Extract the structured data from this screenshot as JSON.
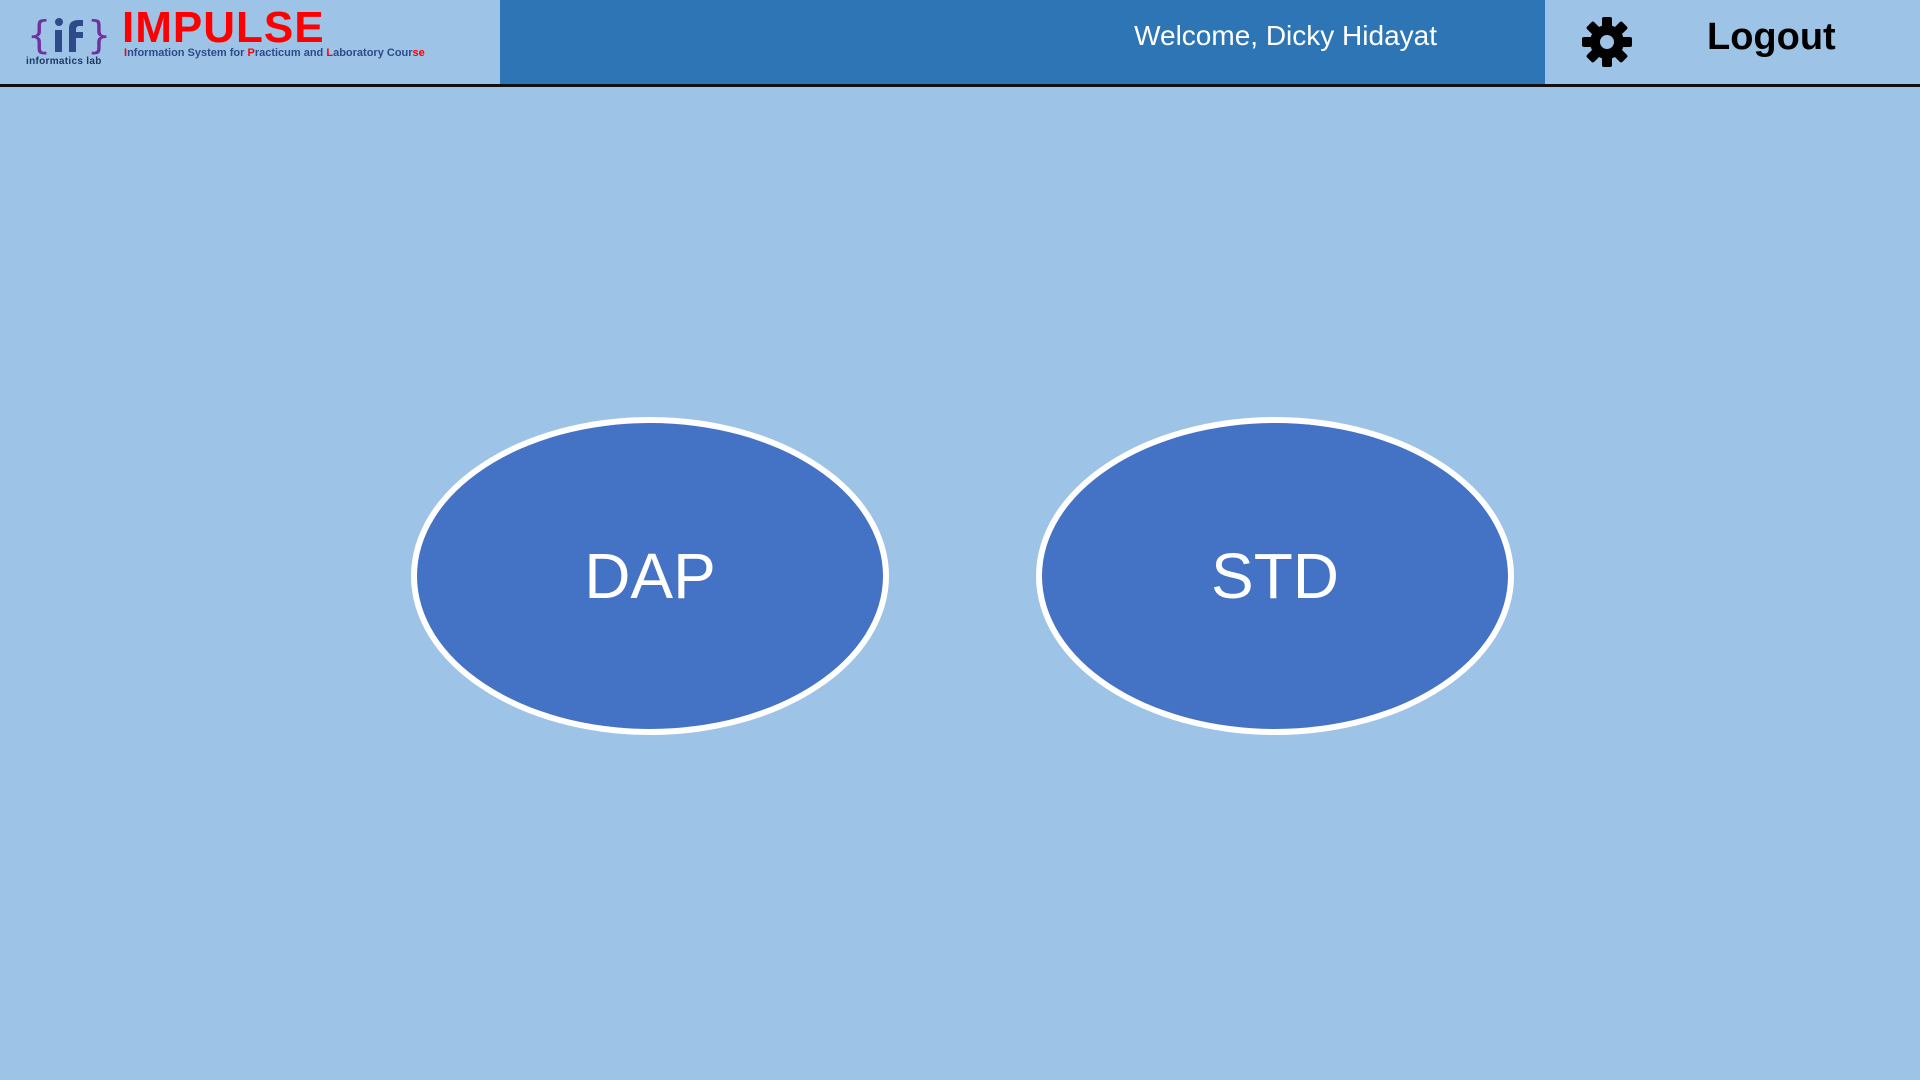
{
  "header": {
    "logo": {
      "mark_label": "informatics lab",
      "title": "IMPULSE",
      "tagline_parts": [
        {
          "text": "I",
          "red": true
        },
        {
          "text": "nformation System for ",
          "red": false
        },
        {
          "text": "P",
          "red": true
        },
        {
          "text": "racticum and ",
          "red": false
        },
        {
          "text": "L",
          "red": true
        },
        {
          "text": "aboratory Cour",
          "red": false
        },
        {
          "text": "se",
          "red": true
        }
      ]
    },
    "welcome_text": "Welcome, Dicky Hidayat",
    "settings_icon": "gear-icon",
    "logout_label": "Logout"
  },
  "main": {
    "buttons": [
      {
        "label": "DAP"
      },
      {
        "label": "STD"
      }
    ]
  },
  "colors": {
    "background": "#9dc3e6",
    "header_bar": "#2e75b6",
    "button_fill": "#4472c4",
    "button_border": "#ffffff",
    "logo_red": "#ff0000"
  }
}
